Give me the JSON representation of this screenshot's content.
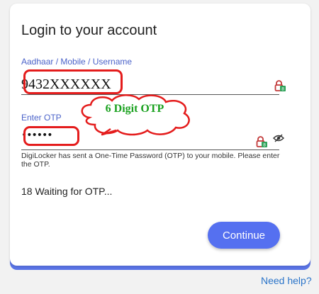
{
  "login": {
    "title": "Login to your account",
    "username_label": "Aadhaar / Mobile / Username",
    "username_value": "9432XXXXXX",
    "otp_label": "Enter OTP",
    "otp_value": "••••••",
    "otp_note": "DigiLocker has sent a One-Time Password (OTP) to your mobile. Please enter the OTP.",
    "status": "18 Waiting for OTP...",
    "continue_label": "Continue",
    "help_link": "Need help?"
  },
  "annotation": {
    "callout_text": "6 Digit OTP"
  },
  "icons": {
    "field_badge": "lock-badge-icon",
    "show_password": "eye-slash-icon"
  },
  "colors": {
    "accent": "#5570f0",
    "label_blue": "#4a62c9",
    "highlight_red": "#e41c1c",
    "callout_green": "#1aa11f",
    "link": "#2a74c9"
  }
}
